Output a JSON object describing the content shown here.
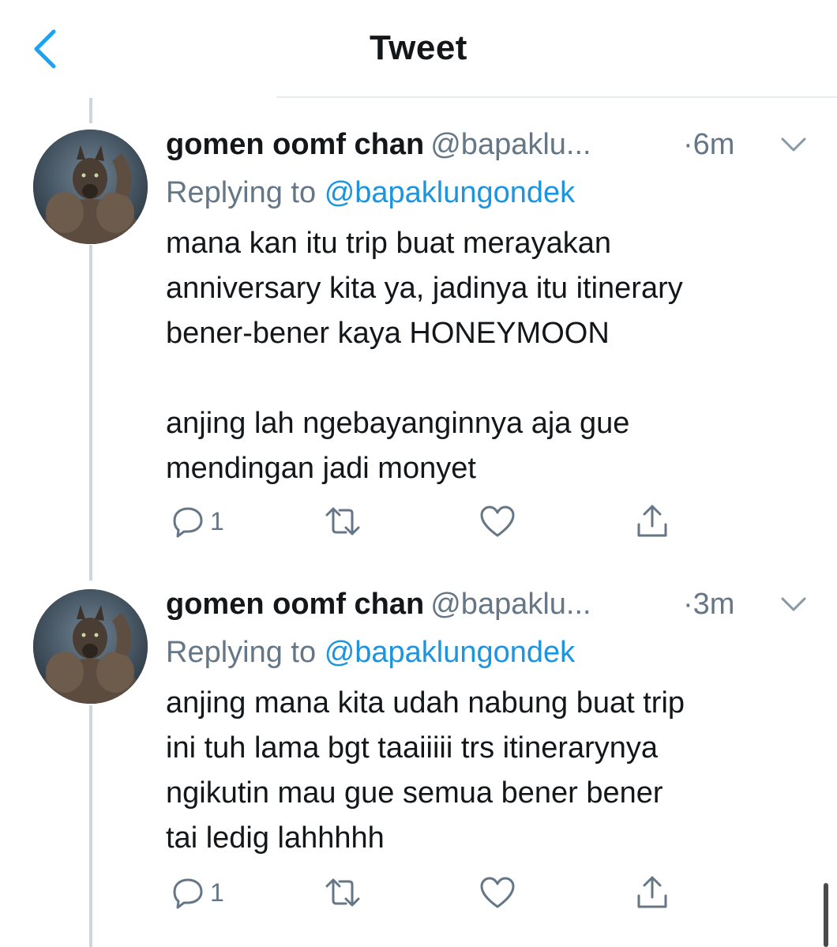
{
  "header": {
    "title": "Tweet",
    "back_icon": "chevron-left-icon",
    "accent": "#1da1f2"
  },
  "tweets": [
    {
      "name": "gomen oomf chan",
      "handle": "@bapaklu...",
      "time": "·6m",
      "replying_prefix": "Replying to",
      "replying_to": "@bapaklungondek",
      "text": "mana kan itu trip buat merayakan\nanniversary kita ya, jadinya itu itinerary\nbener-bener kaya HONEYMOON\n\nanjing lah ngebayanginnya aja gue\nmendingan jadi monyet",
      "reply_count": "1"
    },
    {
      "name": "gomen oomf chan",
      "handle": "@bapaklu...",
      "time": "·3m",
      "replying_prefix": "Replying to",
      "replying_to": "@bapaklungondek",
      "text": "anjing mana kita udah nabung buat trip\nini tuh lama bgt taaiiiii trs itinerarynya\nngikutin mau gue semua bener bener\ntai ledig lahhhhh",
      "reply_count": "1"
    }
  ],
  "colors": {
    "text": "#14171a",
    "secondary": "#657786",
    "link": "#1b95e0",
    "thread_line": "#ccd6dd"
  }
}
